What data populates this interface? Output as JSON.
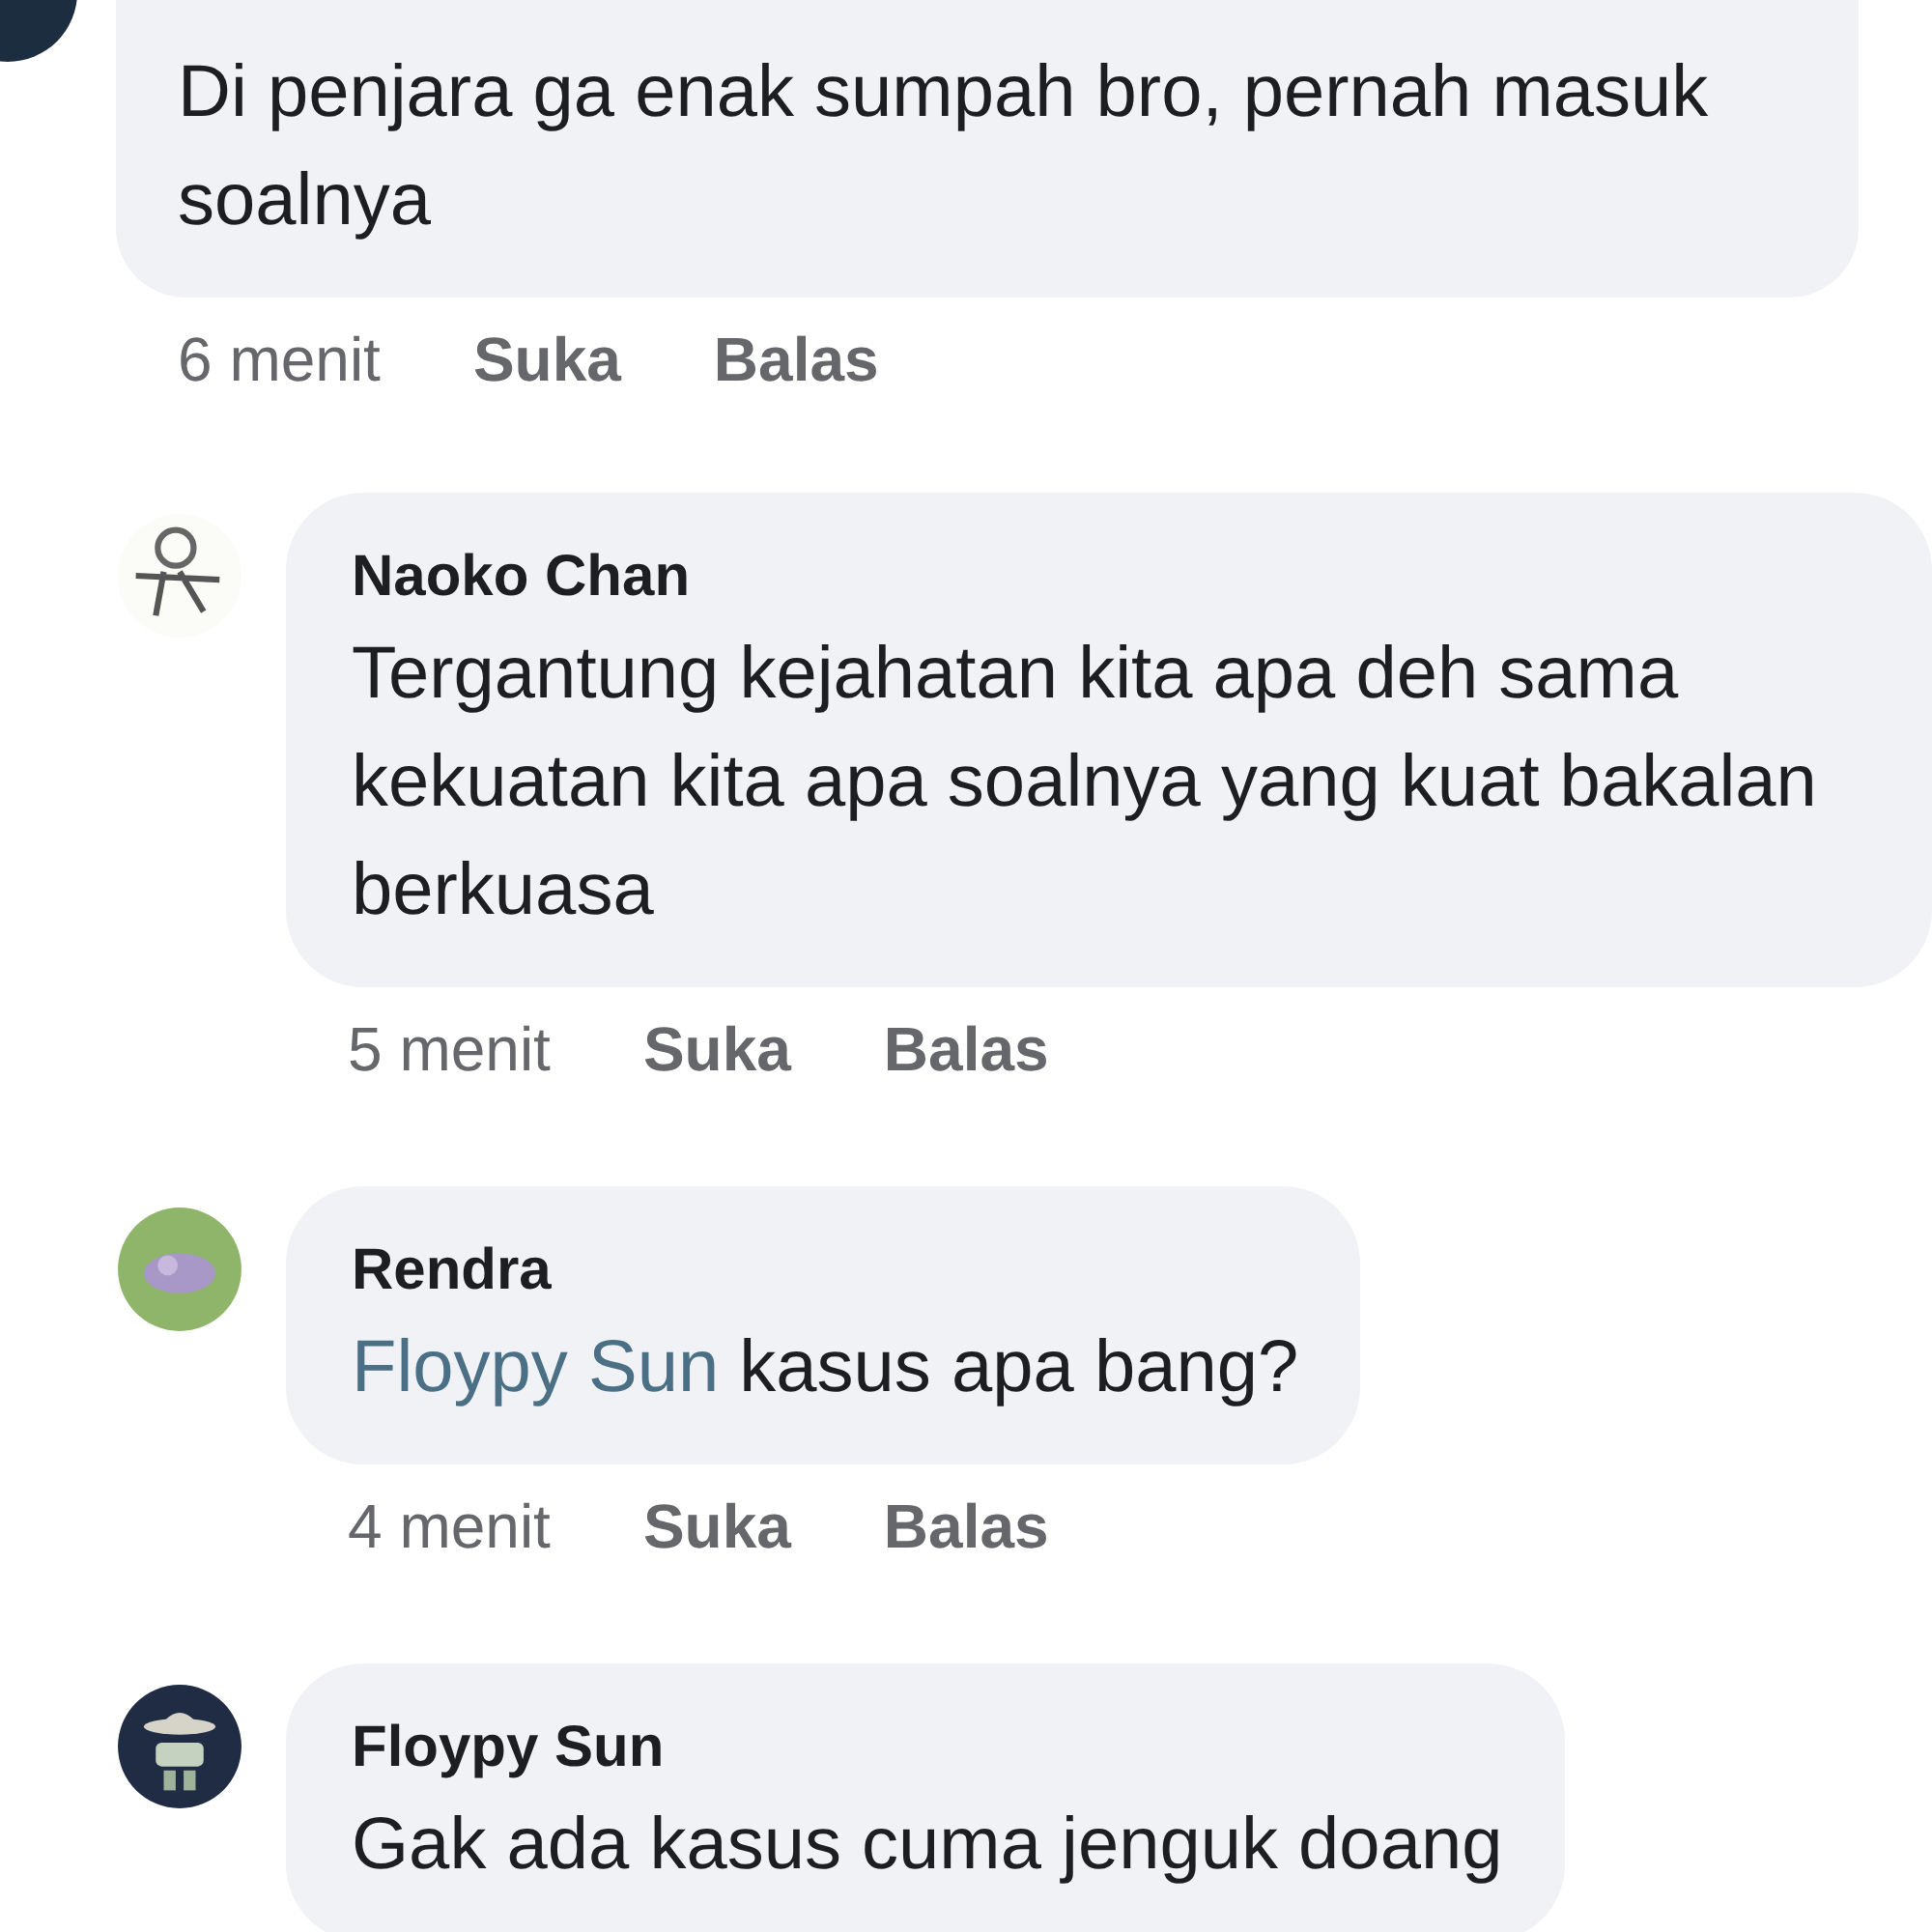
{
  "comments": [
    {
      "text": "Di penjara ga enak sumpah bro, pernah masuk soalnya",
      "time": "6 menit",
      "actions": [
        "Suka",
        "Balas"
      ],
      "children": [
        {
          "author": "Naoko Chan",
          "text": "Tergantung kejahatan kita apa deh sama kekuatan kita apa soalnya yang kuat bakalan berkuasa",
          "time": "5 menit",
          "actions": [
            "Suka",
            "Balas"
          ]
        },
        {
          "author": "Rendra",
          "mention": "Floypy Sun",
          "text": "kasus apa bang?",
          "time": "4 menit",
          "actions": [
            "Suka",
            "Balas"
          ]
        },
        {
          "author": "Floypy Sun",
          "text": "Gak ada kasus cuma jenguk doang"
        }
      ]
    }
  ]
}
